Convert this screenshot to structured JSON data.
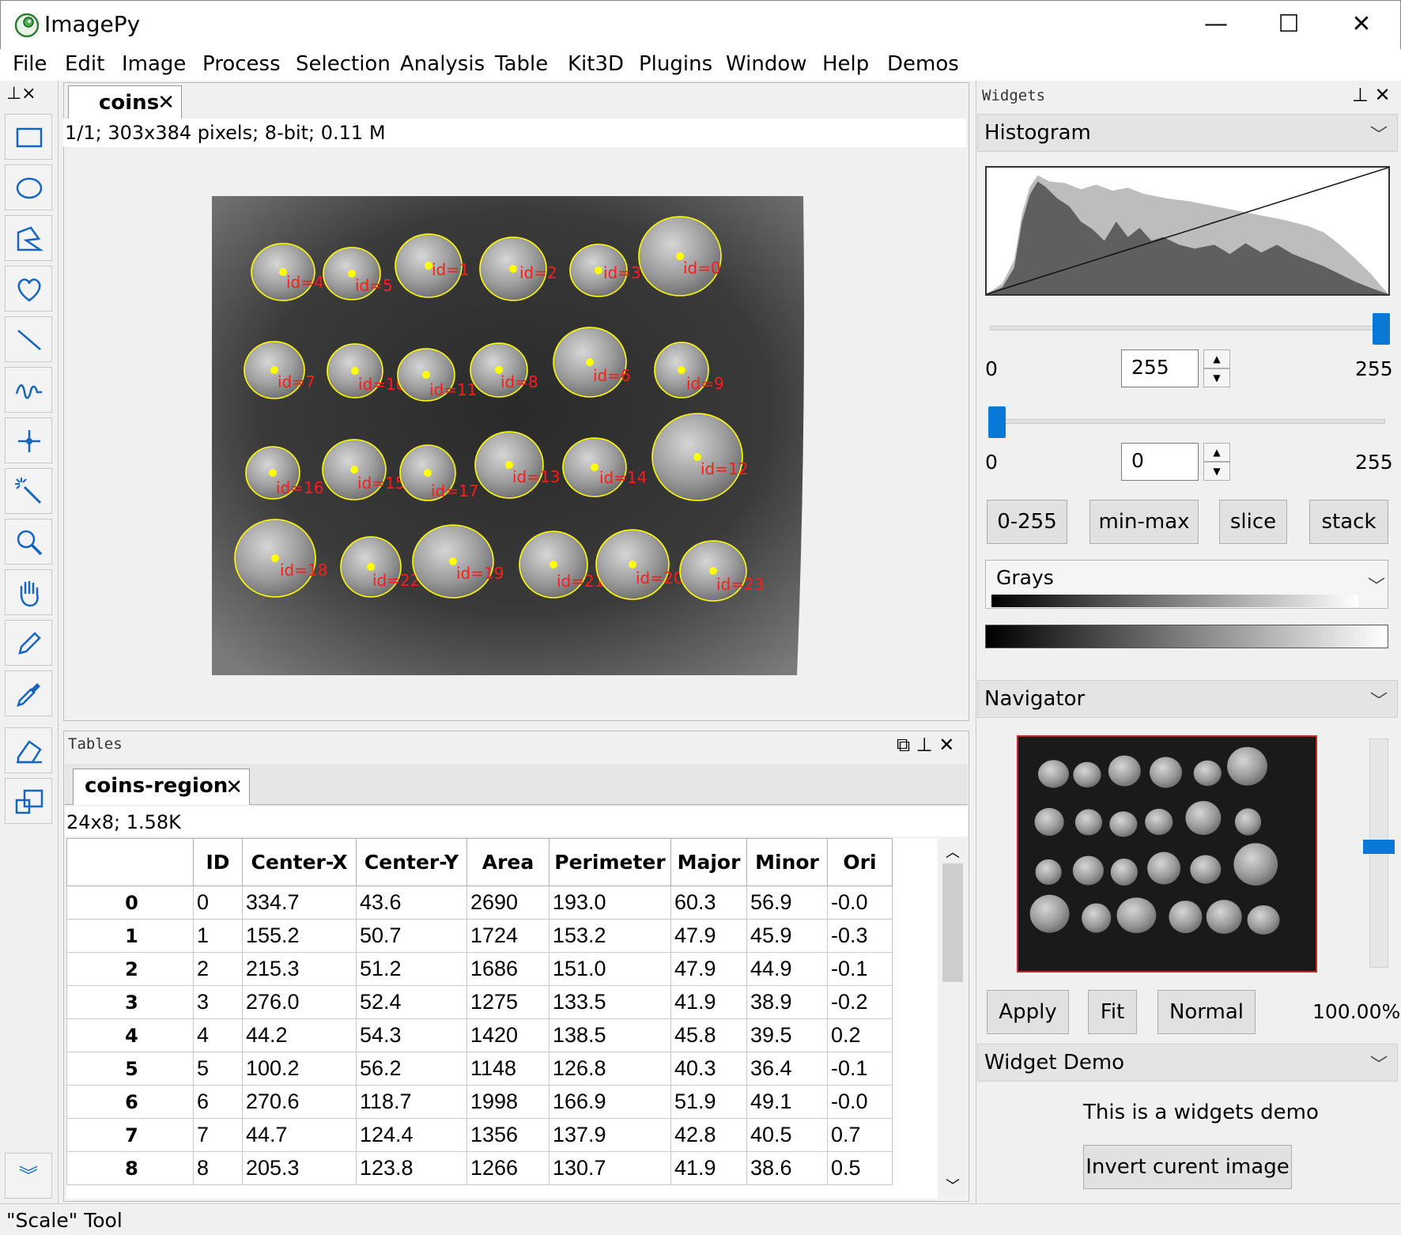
{
  "window": {
    "title": "ImagePy",
    "controls": {
      "minimize": "—",
      "maximize": "☐",
      "close": "✕"
    }
  },
  "menu": [
    "File",
    "Edit",
    "Image",
    "Process",
    "Selection",
    "Analysis",
    "Table",
    "Kit3D",
    "Plugins",
    "Window",
    "Help",
    "Demos"
  ],
  "toolbar": {
    "header": "⊥×",
    "tools": [
      "rectangle-select-icon",
      "ellipse-select-icon",
      "polygon-select-icon",
      "freehand-select-icon",
      "line-icon",
      "freeline-icon",
      "point-icon",
      "magic-wand-icon",
      "zoom-icon",
      "hand-icon",
      "pencil-icon",
      "color-picker-icon",
      "eraser-icon",
      "scale-icon"
    ],
    "more": "︾"
  },
  "image_window": {
    "tab_label": "coins",
    "tab_close": "✕",
    "info": "1/1;   303x384 pixels; 8-bit; 0.11 M",
    "regions": [
      {
        "label": "id=4"
      },
      {
        "label": "id=5"
      },
      {
        "label": "id=1"
      },
      {
        "label": "id=2"
      },
      {
        "label": "id=3"
      },
      {
        "label": "id=0"
      },
      {
        "label": "id=7"
      },
      {
        "label": "id=10"
      },
      {
        "label": "id=11"
      },
      {
        "label": "id=8"
      },
      {
        "label": "id=6"
      },
      {
        "label": "id=9"
      },
      {
        "label": "id=16"
      },
      {
        "label": "id=15"
      },
      {
        "label": "id=17"
      },
      {
        "label": "id=13"
      },
      {
        "label": "id=14"
      },
      {
        "label": "id=12"
      },
      {
        "label": "id=18"
      },
      {
        "label": "id=22"
      },
      {
        "label": "id=19"
      },
      {
        "label": "id=21"
      },
      {
        "label": "id=20"
      },
      {
        "label": "id=23"
      }
    ],
    "colors": {
      "outline": "#ffff00",
      "centroid": "#ffff00",
      "label": "#ff1a1a"
    }
  },
  "tables": {
    "header": "Tables",
    "controls": "⧉ ⊥ ✕",
    "tab_label": "coins-region",
    "tab_close": "✕",
    "info": "24x8; 1.58K",
    "columns": [
      "ID",
      "Center-X",
      "Center-Y",
      "Area",
      "Perimeter",
      "Major",
      "Minor",
      "Ori"
    ],
    "rows": [
      {
        "index": "0",
        "cells": [
          "0",
          "334.7",
          "43.6",
          "2690",
          "193.0",
          "60.3",
          "56.9",
          "-0.0"
        ]
      },
      {
        "index": "1",
        "cells": [
          "1",
          "155.2",
          "50.7",
          "1724",
          "153.2",
          "47.9",
          "45.9",
          "-0.3"
        ]
      },
      {
        "index": "2",
        "cells": [
          "2",
          "215.3",
          "51.2",
          "1686",
          "151.0",
          "47.9",
          "44.9",
          "-0.1"
        ]
      },
      {
        "index": "3",
        "cells": [
          "3",
          "276.0",
          "52.4",
          "1275",
          "133.5",
          "41.9",
          "38.9",
          "-0.2"
        ]
      },
      {
        "index": "4",
        "cells": [
          "4",
          "44.2",
          "54.3",
          "1420",
          "138.5",
          "45.8",
          "39.5",
          "0.2"
        ]
      },
      {
        "index": "5",
        "cells": [
          "5",
          "100.2",
          "56.2",
          "1148",
          "126.8",
          "40.3",
          "36.4",
          "-0.1"
        ]
      },
      {
        "index": "6",
        "cells": [
          "6",
          "270.6",
          "118.7",
          "1998",
          "166.9",
          "51.9",
          "49.1",
          "-0.0"
        ]
      },
      {
        "index": "7",
        "cells": [
          "7",
          "44.7",
          "124.4",
          "1356",
          "137.9",
          "42.8",
          "40.5",
          "0.7"
        ]
      },
      {
        "index": "8",
        "cells": [
          "8",
          "205.3",
          "123.8",
          "1266",
          "130.7",
          "41.9",
          "38.6",
          "0.5"
        ]
      }
    ],
    "scroll_up": "︿",
    "scroll_down": "﹀"
  },
  "status": "\"Scale\" Tool",
  "widgets": {
    "header": "Widgets",
    "controls": "⊥ ✕",
    "histogram": {
      "title": "Histogram",
      "chevron": "﹀",
      "high": {
        "min_label": "0",
        "max_label": "255",
        "value": "255",
        "fraction": 1.0
      },
      "low": {
        "min_label": "0",
        "max_label": "255",
        "value": "0",
        "fraction": 0.0
      },
      "spin_up": "▲",
      "spin_down": "▼",
      "buttons": [
        "0-255",
        "min-max",
        "slice",
        "stack"
      ],
      "colormap": "Grays"
    },
    "navigator": {
      "title": "Navigator",
      "chevron": "﹀",
      "buttons": [
        "Apply",
        "Fit",
        "Normal"
      ],
      "zoom": "100.00%"
    },
    "demo": {
      "title": "Widget Demo",
      "chevron": "﹀",
      "text": "This is a widgets demo",
      "button": "Invert curent image"
    }
  }
}
